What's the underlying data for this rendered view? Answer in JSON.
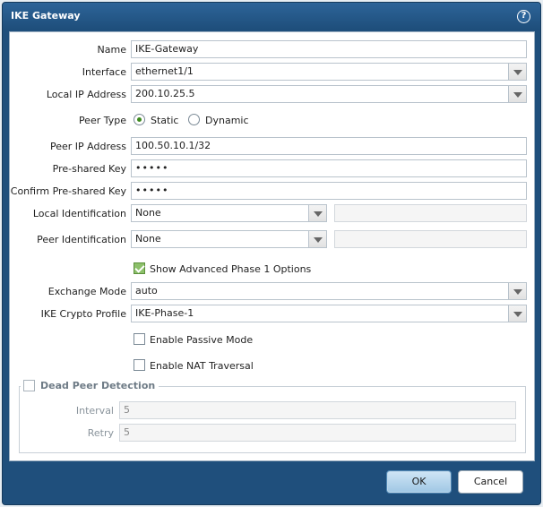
{
  "dialog": {
    "title": "IKE Gateway",
    "help_icon": "question-mark-icon"
  },
  "form": {
    "name": {
      "label": "Name",
      "value": "IKE-Gateway"
    },
    "interface": {
      "label": "Interface",
      "value": "ethernet1/1"
    },
    "local_ip": {
      "label": "Local IP Address",
      "value": "200.10.25.5"
    },
    "peer_type": {
      "label": "Peer Type",
      "options": [
        "Static",
        "Dynamic"
      ],
      "selected": "Static"
    },
    "peer_ip": {
      "label": "Peer IP Address",
      "value": "100.50.10.1/32"
    },
    "preshared_key": {
      "label": "Pre-shared Key",
      "value": "•••••"
    },
    "confirm_preshared_key": {
      "label": "Confirm Pre-shared Key",
      "value": "•••••"
    },
    "local_identification": {
      "label": "Local Identification",
      "value": "None",
      "extra_value": ""
    },
    "peer_identification": {
      "label": "Peer Identification",
      "value": "None",
      "extra_value": ""
    },
    "show_advanced": {
      "label": "Show Advanced Phase 1 Options",
      "checked": true
    },
    "exchange_mode": {
      "label": "Exchange Mode",
      "value": "auto"
    },
    "ike_crypto_profile": {
      "label": "IKE Crypto Profile",
      "value": "IKE-Phase-1"
    },
    "passive_mode": {
      "label": "Enable Passive Mode",
      "checked": false
    },
    "nat_traversal": {
      "label": "Enable NAT Traversal",
      "checked": false
    },
    "dpd": {
      "label": "Dead Peer Detection",
      "checked": false,
      "interval": {
        "label": "Interval",
        "value": "5"
      },
      "retry": {
        "label": "Retry",
        "value": "5"
      }
    }
  },
  "buttons": {
    "ok": "OK",
    "cancel": "Cancel"
  },
  "colors": {
    "frame": "#1f4f7c",
    "check_green": "#8cc06a"
  }
}
